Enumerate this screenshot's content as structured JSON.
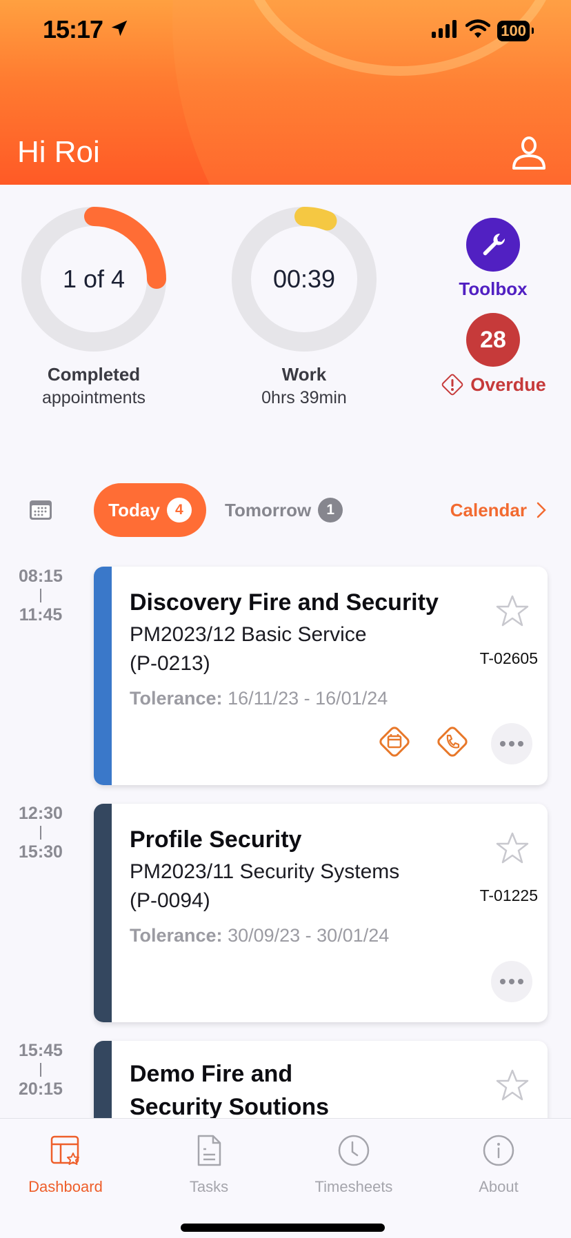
{
  "status_bar": {
    "time": "15:17",
    "battery": "100"
  },
  "header": {
    "greeting": "Hi Roi"
  },
  "stats": {
    "completed": {
      "value": "1 of 4",
      "label": "Completed",
      "sub": "appointments",
      "progress": 0.25,
      "color": "#FF6D35"
    },
    "work": {
      "value": "00:39",
      "label": "Work",
      "sub": "0hrs 39min",
      "progress": 0.06,
      "color": "#F5C842"
    },
    "toolbox": {
      "label": "Toolbox",
      "color": "#5120C2"
    },
    "overdue": {
      "count": "28",
      "label": "Overdue",
      "color": "#C63A3A"
    }
  },
  "tabs": {
    "today": {
      "label": "Today",
      "count": "4"
    },
    "tomorrow": {
      "label": "Tomorrow",
      "count": "1"
    },
    "calendar": {
      "label": "Calendar"
    }
  },
  "appointments": [
    {
      "start": "08:15",
      "end": "11:45",
      "title": "Discovery Fire and Security",
      "subtitle_line1": "PM2023/12 Basic Service",
      "subtitle_line2": "(P-0213)",
      "tolerance_label": "Tolerance:",
      "tolerance": "16/11/23 - 16/01/24",
      "ref": "T-02605",
      "accent": "#3A78C9",
      "actions": [
        "calendar-icon",
        "phone-icon",
        "more-icon"
      ]
    },
    {
      "start": "12:30",
      "end": "15:30",
      "title": "Profile Security",
      "subtitle_line1": "PM2023/11 Security Systems",
      "subtitle_line2": "(P-0094)",
      "tolerance_label": "Tolerance:",
      "tolerance": "30/09/23 - 30/01/24",
      "ref": "T-01225",
      "accent": "#34475F",
      "actions": [
        "more-icon"
      ]
    },
    {
      "start": "15:45",
      "end": "20:15",
      "title_line1": "Demo Fire and",
      "title_line2": "Security Soutions",
      "accent": "#34475F"
    }
  ],
  "nav": [
    {
      "label": "Dashboard",
      "icon": "dashboard-icon",
      "active": true
    },
    {
      "label": "Tasks",
      "icon": "document-icon",
      "active": false
    },
    {
      "label": "Timesheets",
      "icon": "clock-icon",
      "active": false
    },
    {
      "label": "About",
      "icon": "info-icon",
      "active": false
    }
  ]
}
